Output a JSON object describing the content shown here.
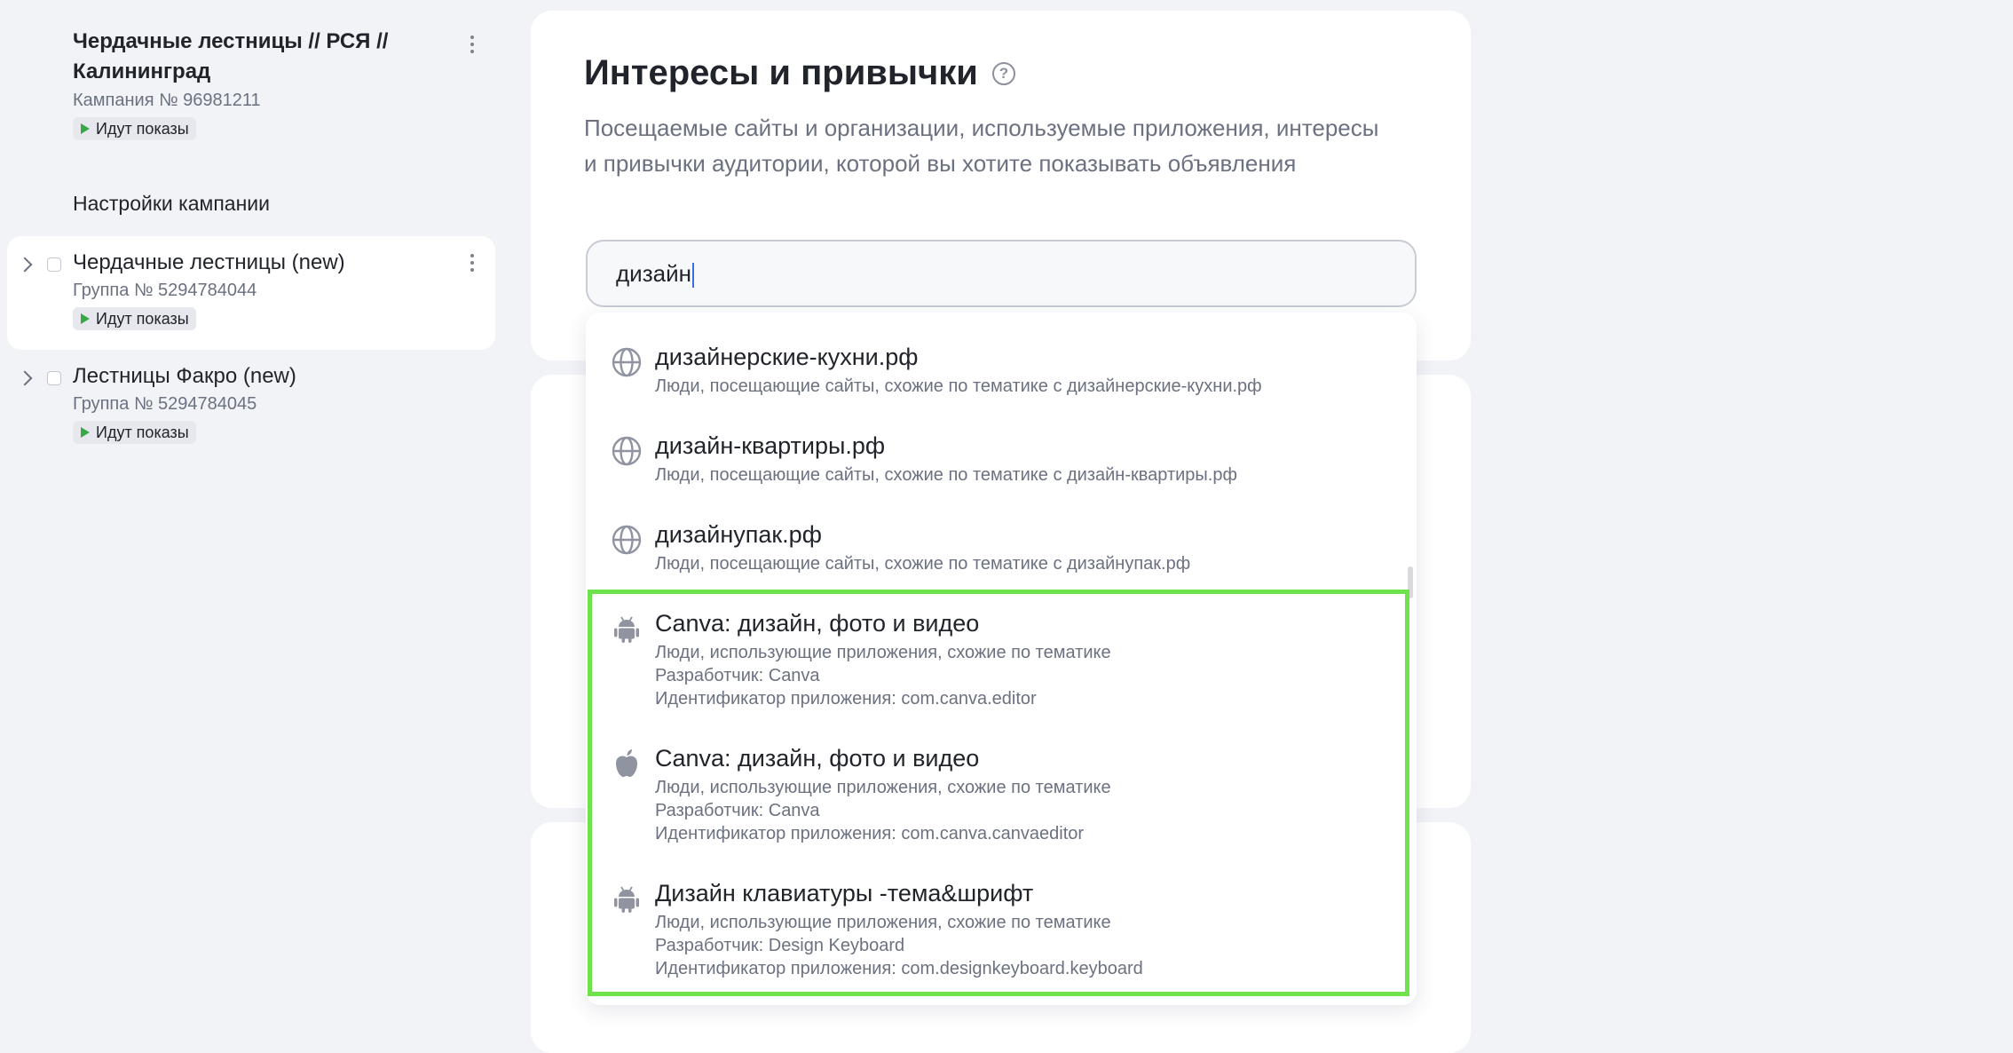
{
  "sidebar": {
    "campaign": {
      "title": "Чердачные лестницы // РСЯ // Калининград",
      "number": "Кампания № 96981211",
      "status": "Идут показы"
    },
    "settings_label": "Настройки кампании",
    "groups": [
      {
        "title": "Чердачные лестницы (new)",
        "number": "Группа № 5294784044",
        "status": "Идут показы"
      },
      {
        "title": "Лестницы Факро (new)",
        "number": "Группа № 5294784045",
        "status": "Идут показы"
      }
    ]
  },
  "main": {
    "title": "Интересы и привычки",
    "help": "?",
    "description": "Посещаемые сайты и организации, используемые приложения, интересы и привычки аудитории, которой вы хотите показывать объявления",
    "search": {
      "value": "дизайн"
    }
  },
  "dropdown": {
    "items": [
      {
        "icon": "globe-icon",
        "title": "дизайнерские-кухни.рф",
        "lines": [
          "Люди, посещающие сайты, схожие по тематике с дизайнерские-кухни.рф"
        ]
      },
      {
        "icon": "globe-icon",
        "title": "дизайн-квартиры.рф",
        "lines": [
          "Люди, посещающие сайты, схожие по тематике с дизайн-квартиры.рф"
        ]
      },
      {
        "icon": "globe-icon",
        "title": "дизайнупак.рф",
        "lines": [
          "Люди, посещающие сайты, схожие по тематике с дизайнупак.рф"
        ]
      },
      {
        "icon": "android-icon",
        "title": "Canva: дизайн, фото и видео",
        "lines": [
          "Люди, использующие приложения, схожие по тематике",
          "Разработчик: Canva",
          "Идентификатор приложения: com.canva.editor"
        ]
      },
      {
        "icon": "apple-icon",
        "title": "Canva: дизайн, фото и видео",
        "lines": [
          "Люди, использующие приложения, схожие по тематике",
          "Разработчик: Canva",
          "Идентификатор приложения: com.canva.canvaeditor"
        ]
      },
      {
        "icon": "android-icon",
        "title": "Дизайн клавиатуры -тема&шрифт",
        "lines": [
          "Люди, использующие приложения, схожие по тематике",
          "Разработчик: Design Keyboard",
          "Идентификатор приложения: com.designkeyboard.keyboard"
        ]
      }
    ]
  },
  "colors": {
    "highlight": "#6ee24a",
    "status_play": "#3aa847",
    "background": "#f2f3f7"
  }
}
